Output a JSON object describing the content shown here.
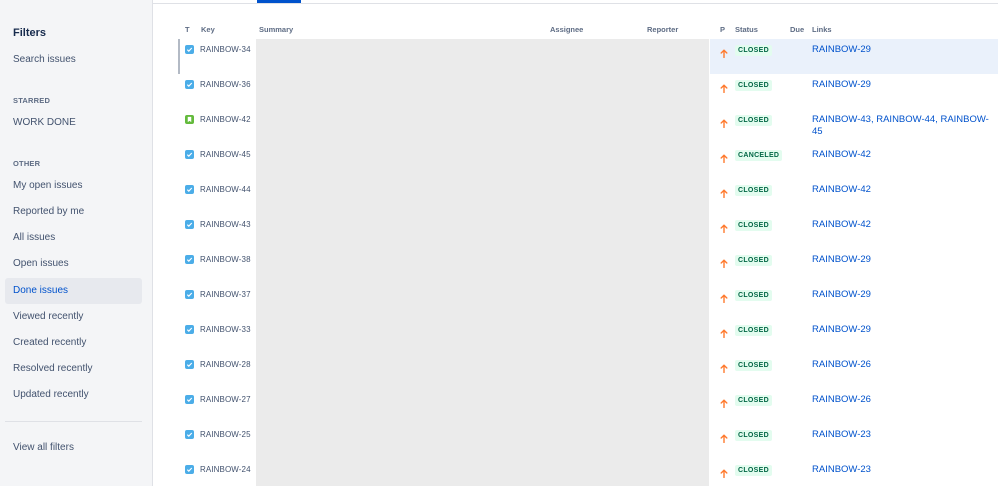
{
  "sidebar": {
    "title": "Filters",
    "search_label": "Search issues",
    "starred_heading": "STARRED",
    "starred_items": [
      {
        "label": "WORK DONE"
      }
    ],
    "other_heading": "OTHER",
    "other_items": [
      {
        "label": "My open issues"
      },
      {
        "label": "Reported by me"
      },
      {
        "label": "All issues"
      },
      {
        "label": "Open issues"
      },
      {
        "label": "Done issues"
      },
      {
        "label": "Viewed recently"
      },
      {
        "label": "Created recently"
      },
      {
        "label": "Resolved recently"
      },
      {
        "label": "Updated recently"
      }
    ],
    "active_item": "Done issues",
    "view_all_label": "View all filters"
  },
  "table": {
    "columns": {
      "type": "T",
      "key": "Key",
      "summary": "Summary",
      "assignee": "Assignee",
      "reporter": "Reporter",
      "priority": "P",
      "status": "Status",
      "due": "Due",
      "links": "Links"
    },
    "rows": [
      {
        "type_icon": "task-checkbox-icon",
        "key": "RAINBOW-34",
        "status": "CLOSED",
        "links": "RAINBOW-29",
        "selected": true
      },
      {
        "type_icon": "task-checkbox-icon",
        "key": "RAINBOW-36",
        "status": "CLOSED",
        "links": "RAINBOW-29"
      },
      {
        "type_icon": "story-bookmark-icon",
        "key": "RAINBOW-42",
        "status": "CLOSED",
        "links": "RAINBOW-43, RAINBOW-44, RAINBOW-45"
      },
      {
        "type_icon": "task-checkbox-icon",
        "key": "RAINBOW-45",
        "status": "CANCELED",
        "links": "RAINBOW-42"
      },
      {
        "type_icon": "task-checkbox-icon",
        "key": "RAINBOW-44",
        "status": "CLOSED",
        "links": "RAINBOW-42"
      },
      {
        "type_icon": "task-checkbox-icon",
        "key": "RAINBOW-43",
        "status": "CLOSED",
        "links": "RAINBOW-42"
      },
      {
        "type_icon": "task-checkbox-icon",
        "key": "RAINBOW-38",
        "status": "CLOSED",
        "links": "RAINBOW-29"
      },
      {
        "type_icon": "task-checkbox-icon",
        "key": "RAINBOW-37",
        "status": "CLOSED",
        "links": "RAINBOW-29"
      },
      {
        "type_icon": "task-checkbox-icon",
        "key": "RAINBOW-33",
        "status": "CLOSED",
        "links": "RAINBOW-29"
      },
      {
        "type_icon": "task-checkbox-icon",
        "key": "RAINBOW-28",
        "status": "CLOSED",
        "links": "RAINBOW-26"
      },
      {
        "type_icon": "task-checkbox-icon",
        "key": "RAINBOW-27",
        "status": "CLOSED",
        "links": "RAINBOW-26"
      },
      {
        "type_icon": "task-checkbox-icon",
        "key": "RAINBOW-25",
        "status": "CLOSED",
        "links": "RAINBOW-23"
      },
      {
        "type_icon": "task-checkbox-icon",
        "key": "RAINBOW-24",
        "status": "CLOSED",
        "links": "RAINBOW-23"
      }
    ],
    "priority_icon": "priority-high-arrow-icon"
  },
  "colors": {
    "accent": "#0052cc",
    "sidebar_bg": "#f4f5f7",
    "status_green_text": "#006644",
    "status_green_bg": "#e3fcef",
    "priority_orange": "#ff7a2e",
    "task_icon": "#4bade8",
    "story_icon": "#63ba3c",
    "redacted_area": "#ebebeb",
    "selected_row": "#eaf1fb"
  }
}
